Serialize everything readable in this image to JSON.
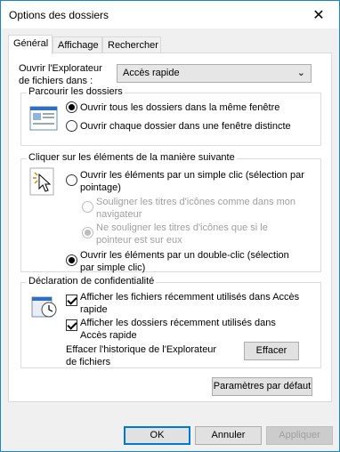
{
  "window": {
    "title": "Options des dossiers",
    "close_glyph": "✕"
  },
  "tabs": [
    {
      "label": "Général",
      "active": true
    },
    {
      "label": "Affichage"
    },
    {
      "label": "Rechercher"
    }
  ],
  "open_explorer": {
    "label": "Ouvrir l'Explorateur de fichiers dans :",
    "selected": "Accès rapide"
  },
  "browse_group": {
    "title": "Parcourir les dossiers",
    "options": [
      {
        "label": "Ouvrir tous les dossiers dans la même fenêtre",
        "checked": true
      },
      {
        "label": "Ouvrir chaque dossier dans une fenêtre distincte",
        "checked": false
      }
    ]
  },
  "click_group": {
    "title": "Cliquer sur les éléments de la manière suivante",
    "single_click": "Ouvrir les éléments par un simple clic (sélection par pointage)",
    "underline_always": "Souligner les titres d'icônes comme dans mon navigateur",
    "underline_hover": "Ne souligner les titres d'icônes que si le pointeur est sur eux",
    "double_click": "Ouvrir les éléments par un double-clic (sélection par simple clic)"
  },
  "privacy_group": {
    "title": "Déclaration de confidentialité",
    "show_recent_files": "Afficher les fichiers récemment utilisés dans Accès rapide",
    "show_frequent_folders": "Afficher les dossiers récemment utilisés dans Accès rapide",
    "clear_history_label": "Effacer l'historique de l'Explorateur de fichiers",
    "clear_button": "Effacer"
  },
  "restore_defaults": "Paramètres par défaut",
  "footer": {
    "ok": "OK",
    "cancel": "Annuler",
    "apply": "Appliquer"
  },
  "colors": {
    "accent": "#0078d7",
    "border": "#1883d7"
  }
}
